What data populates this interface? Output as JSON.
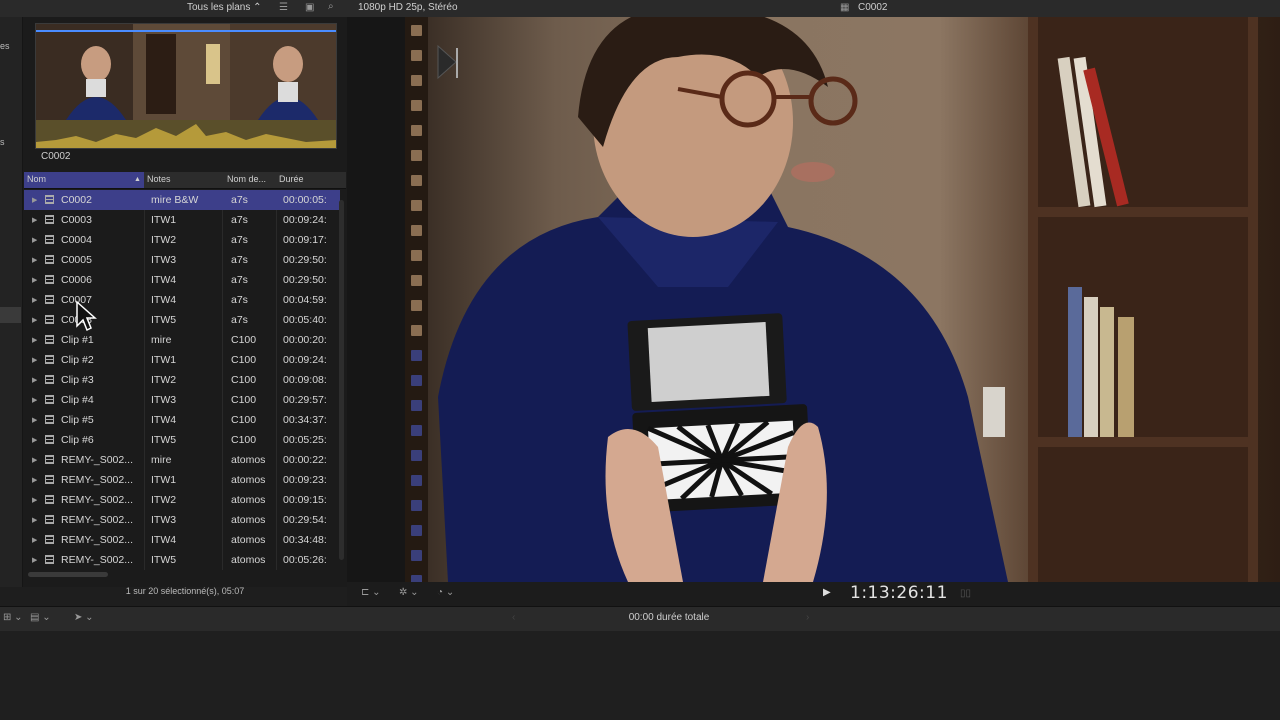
{
  "topbar": {
    "filter_label": "Tous les plans",
    "format": "1080p HD 25p, Stéréo",
    "viewer_title": "C0002"
  },
  "filmstrip": {
    "label": "C0002"
  },
  "browser": {
    "columns": [
      "Nom",
      "Notes",
      "Nom de...",
      "Durée"
    ],
    "rows": [
      {
        "name": "C0002",
        "notes": "mire B&W",
        "cam": "a7s",
        "dur": "00:00:05:"
      },
      {
        "name": "C0003",
        "notes": "ITW1",
        "cam": "a7s",
        "dur": "00:09:24:"
      },
      {
        "name": "C0004",
        "notes": "ITW2",
        "cam": "a7s",
        "dur": "00:09:17:"
      },
      {
        "name": "C0005",
        "notes": "ITW3",
        "cam": "a7s",
        "dur": "00:29:50:"
      },
      {
        "name": "C0006",
        "notes": "ITW4",
        "cam": "a7s",
        "dur": "00:29:50:"
      },
      {
        "name": "C0007",
        "notes": "ITW4",
        "cam": "a7s",
        "dur": "00:04:59:"
      },
      {
        "name": "C0008",
        "notes": "ITW5",
        "cam": "a7s",
        "dur": "00:05:40:"
      },
      {
        "name": "Clip #1",
        "notes": "mire",
        "cam": "C100",
        "dur": "00:00:20:"
      },
      {
        "name": "Clip #2",
        "notes": "ITW1",
        "cam": "C100",
        "dur": "00:09:24:"
      },
      {
        "name": "Clip #3",
        "notes": "ITW2",
        "cam": "C100",
        "dur": "00:09:08:"
      },
      {
        "name": "Clip #4",
        "notes": "ITW3",
        "cam": "C100",
        "dur": "00:29:57:"
      },
      {
        "name": "Clip #5",
        "notes": "ITW4",
        "cam": "C100",
        "dur": "00:34:37:"
      },
      {
        "name": "Clip #6",
        "notes": "ITW5",
        "cam": "C100",
        "dur": "00:05:25:"
      },
      {
        "name": "REMY-_S002...",
        "notes": "mire",
        "cam": "atomos",
        "dur": "00:00:22:"
      },
      {
        "name": "REMY-_S002...",
        "notes": "ITW1",
        "cam": "atomos",
        "dur": "00:09:23:"
      },
      {
        "name": "REMY-_S002...",
        "notes": "ITW2",
        "cam": "atomos",
        "dur": "00:09:15:"
      },
      {
        "name": "REMY-_S002...",
        "notes": "ITW3",
        "cam": "atomos",
        "dur": "00:29:54:"
      },
      {
        "name": "REMY-_S002...",
        "notes": "ITW4",
        "cam": "atomos",
        "dur": "00:34:48:"
      },
      {
        "name": "REMY-_S002...",
        "notes": "ITW5",
        "cam": "atomos",
        "dur": "00:05:26:"
      }
    ],
    "status": "1 sur 20 sélectionné(s), 05:07"
  },
  "viewer": {
    "timecode": "1:13:26:11"
  },
  "timeline": {
    "duration": "00:00 durée totale"
  },
  "colors": {
    "selection": "#3d3f8a",
    "accent": "#4a8cff"
  }
}
